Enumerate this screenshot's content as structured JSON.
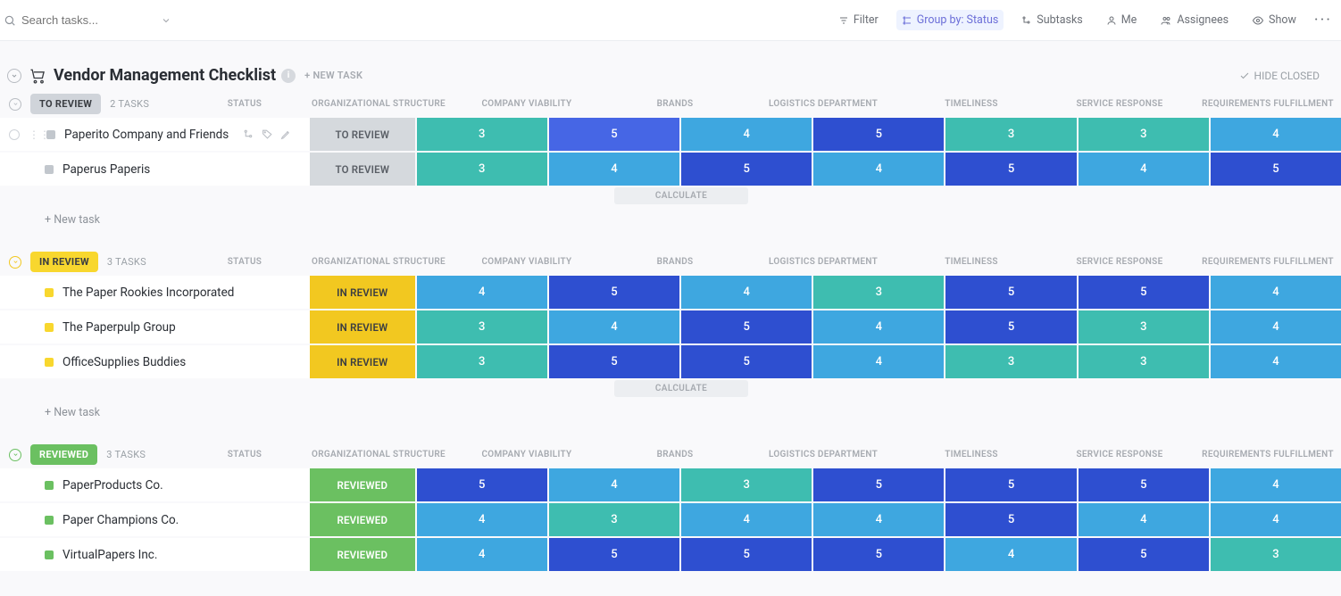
{
  "search": {
    "placeholder": "Search tasks..."
  },
  "toolbar": {
    "filter": "Filter",
    "group_by": "Group by: Status",
    "subtasks": "Subtasks",
    "me": "Me",
    "assignees": "Assignees",
    "show": "Show"
  },
  "list": {
    "title": "Vendor Management Checklist",
    "new_task": "+ NEW TASK",
    "hide_closed": "HIDE CLOSED"
  },
  "columns": {
    "status": "STATUS",
    "c0": "ORGANIZATIONAL STRUCTURE",
    "c1": "COMPANY VIABILITY",
    "c2": "BRANDS",
    "c3": "LOGISTICS DEPARTMENT",
    "c4": "TIMELINESS",
    "c5": "SERVICE RESPONSE",
    "c6": "REQUIREMENTS FULFILLMENT"
  },
  "labels": {
    "new_task_row": "+ New task",
    "calculate": "CALCULATE"
  },
  "colors": {
    "3": "#3ebdb0",
    "4": "#3ea7e0",
    "5": "#2e4fd0",
    "5b": "#4666e5"
  },
  "groups": [
    {
      "id": "to_review",
      "label": "TO REVIEW",
      "pill_class": "pill-toreview",
      "dot_class": "dot-toreview",
      "status_cell_class": "sc-toreview",
      "status_cell_label": "TO REVIEW",
      "count": "2 TASKS",
      "caret_color": "#b9bdc3",
      "show_calculate": true,
      "show_new_task": true,
      "tasks": [
        {
          "name": "Paperito Company and Friends",
          "hover": true,
          "cells": [
            {
              "v": "3",
              "c": "#3ebdb0"
            },
            {
              "v": "5",
              "c": "#4666e5"
            },
            {
              "v": "4",
              "c": "#3ea7e0"
            },
            {
              "v": "5",
              "c": "#2e4fd0"
            },
            {
              "v": "3",
              "c": "#3ebdb0"
            },
            {
              "v": "3",
              "c": "#3ebdb0"
            },
            {
              "v": "4",
              "c": "#3ea7e0"
            }
          ]
        },
        {
          "name": "Paperus Paperis",
          "hover": false,
          "cells": [
            {
              "v": "3",
              "c": "#3ebdb0"
            },
            {
              "v": "4",
              "c": "#3ea7e0"
            },
            {
              "v": "5",
              "c": "#2e4fd0"
            },
            {
              "v": "4",
              "c": "#3ea7e0"
            },
            {
              "v": "5",
              "c": "#2e4fd0"
            },
            {
              "v": "4",
              "c": "#3ea7e0"
            },
            {
              "v": "5",
              "c": "#2e4fd0"
            }
          ]
        }
      ]
    },
    {
      "id": "in_review",
      "label": "IN REVIEW",
      "pill_class": "pill-inreview",
      "dot_class": "dot-inreview",
      "status_cell_class": "sc-inreview",
      "status_cell_label": "IN REVIEW",
      "count": "3 TASKS",
      "caret_color": "#f2c820",
      "show_calculate": true,
      "show_new_task": true,
      "tasks": [
        {
          "name": "The Paper Rookies Incorporated",
          "hover": false,
          "cells": [
            {
              "v": "4",
              "c": "#3ea7e0"
            },
            {
              "v": "5",
              "c": "#2e4fd0"
            },
            {
              "v": "4",
              "c": "#3ea7e0"
            },
            {
              "v": "3",
              "c": "#3ebdb0"
            },
            {
              "v": "5",
              "c": "#2e4fd0"
            },
            {
              "v": "5",
              "c": "#2e4fd0"
            },
            {
              "v": "4",
              "c": "#3ea7e0"
            }
          ]
        },
        {
          "name": "The Paperpulp Group",
          "hover": false,
          "cells": [
            {
              "v": "3",
              "c": "#3ebdb0"
            },
            {
              "v": "4",
              "c": "#3ea7e0"
            },
            {
              "v": "5",
              "c": "#2e4fd0"
            },
            {
              "v": "4",
              "c": "#3ea7e0"
            },
            {
              "v": "5",
              "c": "#2e4fd0"
            },
            {
              "v": "3",
              "c": "#3ebdb0"
            },
            {
              "v": "4",
              "c": "#3ea7e0"
            }
          ]
        },
        {
          "name": "OfficeSupplies Buddies",
          "hover": false,
          "cells": [
            {
              "v": "3",
              "c": "#3ebdb0"
            },
            {
              "v": "5",
              "c": "#2e4fd0"
            },
            {
              "v": "5",
              "c": "#2e4fd0"
            },
            {
              "v": "4",
              "c": "#3ea7e0"
            },
            {
              "v": "3",
              "c": "#3ebdb0"
            },
            {
              "v": "3",
              "c": "#3ebdb0"
            },
            {
              "v": "4",
              "c": "#3ea7e0"
            }
          ]
        }
      ]
    },
    {
      "id": "reviewed",
      "label": "REVIEWED",
      "pill_class": "pill-reviewed",
      "dot_class": "dot-reviewed",
      "status_cell_class": "sc-reviewed",
      "status_cell_label": "REVIEWED",
      "count": "3 TASKS",
      "caret_color": "#6bc061",
      "show_calculate": false,
      "show_new_task": false,
      "tasks": [
        {
          "name": "PaperProducts Co.",
          "hover": false,
          "cells": [
            {
              "v": "5",
              "c": "#2e4fd0"
            },
            {
              "v": "4",
              "c": "#3ea7e0"
            },
            {
              "v": "3",
              "c": "#3ebdb0"
            },
            {
              "v": "5",
              "c": "#2e4fd0"
            },
            {
              "v": "5",
              "c": "#2e4fd0"
            },
            {
              "v": "5",
              "c": "#2e4fd0"
            },
            {
              "v": "4",
              "c": "#3ea7e0"
            }
          ]
        },
        {
          "name": "Paper Champions Co.",
          "hover": false,
          "cells": [
            {
              "v": "4",
              "c": "#3ea7e0"
            },
            {
              "v": "3",
              "c": "#3ebdb0"
            },
            {
              "v": "4",
              "c": "#3ea7e0"
            },
            {
              "v": "4",
              "c": "#3ea7e0"
            },
            {
              "v": "5",
              "c": "#2e4fd0"
            },
            {
              "v": "4",
              "c": "#3ea7e0"
            },
            {
              "v": "4",
              "c": "#3ea7e0"
            }
          ]
        },
        {
          "name": "VirtualPapers Inc.",
          "hover": false,
          "cells": [
            {
              "v": "4",
              "c": "#3ea7e0"
            },
            {
              "v": "5",
              "c": "#2e4fd0"
            },
            {
              "v": "5",
              "c": "#2e4fd0"
            },
            {
              "v": "5",
              "c": "#2e4fd0"
            },
            {
              "v": "4",
              "c": "#3ea7e0"
            },
            {
              "v": "5",
              "c": "#2e4fd0"
            },
            {
              "v": "3",
              "c": "#3ebdb0"
            }
          ]
        }
      ]
    }
  ]
}
